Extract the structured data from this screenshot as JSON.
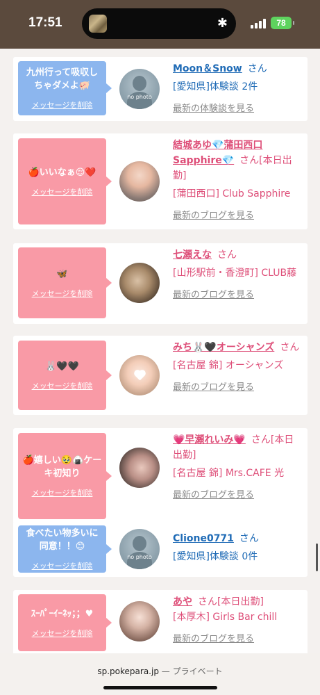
{
  "status": {
    "time": "17:51",
    "battery": "78",
    "bluetooth_icon": "bluetooth-icon",
    "signal_icon": "signal-bars-icon"
  },
  "entries": [
    {
      "message": "九州行って吸収しちゃダメよ🐖",
      "delete": "メッセージを削除",
      "name": "Moon＆Snow",
      "san": "さん",
      "shop": "[愛知県]体験談 2件",
      "link": "最新の体験談を見る",
      "avatar_text": "no photo",
      "color": "blue"
    },
    {
      "message": "🍎いいなぁ😌❤️",
      "delete": "メッセージを削除",
      "name": "結城あゆ💎蒲田西口Sapphire💎",
      "san": "さん[本日出勤]",
      "shop": "[蒲田西口] Club Sapphire",
      "link": "最新のブログを見る",
      "color": "pink"
    },
    {
      "message": "🦋",
      "delete": "メッセージを削除",
      "name": "七瀬えな",
      "san": "さん",
      "shop": "[山形駅前・香澄町] CLUB藤",
      "link": "最新のブログを見る",
      "color": "pink"
    },
    {
      "message": "🐰🖤🖤",
      "delete": "メッセージを削除",
      "name": "みち🐰🖤オーシャンズ",
      "san": "さん",
      "shop": "[名古屋 錦] オーシャンズ",
      "link": "最新のブログを見る",
      "color": "pink"
    },
    {
      "message": "🍎嬉しい🥹🍙ケーキ初知り",
      "delete": "メッセージを削除",
      "name": "💗早瀬れいみ💗",
      "san": "さん[本日出勤]",
      "shop": "[名古屋 錦] Mrs.CAFE 光",
      "link": "最新のブログを見る",
      "color": "pink"
    },
    {
      "message": "食べたい物多いに同意！！😊",
      "delete": "メッセージを削除",
      "name": "Clione0771",
      "san": "さん",
      "shop": "[愛知県]体験談 0件",
      "avatar_text": "no photo",
      "color": "blue"
    },
    {
      "message": "ｽｰﾊﾟｰｲｰﾈｯ；；♥",
      "delete": "メッセージを削除",
      "name": "あや",
      "san": "さん[本日出勤]",
      "shop": "[本厚木] Girls Bar chill",
      "link": "最新のブログを見る",
      "color": "pink"
    }
  ],
  "address_bar": {
    "domain": "sp.pokepara.jp",
    "privacy": "— プライベート"
  }
}
